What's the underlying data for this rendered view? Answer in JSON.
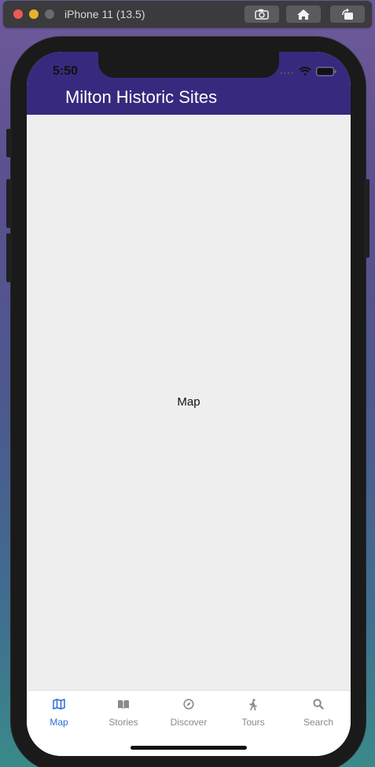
{
  "simulator": {
    "title": "iPhone 11 (13.5)",
    "buttons": [
      "screenshot-icon",
      "home-icon",
      "rotate-icon"
    ]
  },
  "status_bar": {
    "time": "5:50",
    "icons": [
      "signal-icon",
      "wifi-icon",
      "battery-icon"
    ]
  },
  "app": {
    "title": "Milton Historic Sites",
    "header_color": "#372a7e"
  },
  "main": {
    "placeholder": "Map"
  },
  "tabs": [
    {
      "label": "Map",
      "icon": "map-icon",
      "active": true
    },
    {
      "label": "Stories",
      "icon": "book-icon",
      "active": false
    },
    {
      "label": "Discover",
      "icon": "compass-icon",
      "active": false
    },
    {
      "label": "Tours",
      "icon": "walking-icon",
      "active": false
    },
    {
      "label": "Search",
      "icon": "search-icon",
      "active": false
    }
  ],
  "colors": {
    "active_tab": "#2f6bd8",
    "inactive_tab": "#8a8a8e"
  }
}
